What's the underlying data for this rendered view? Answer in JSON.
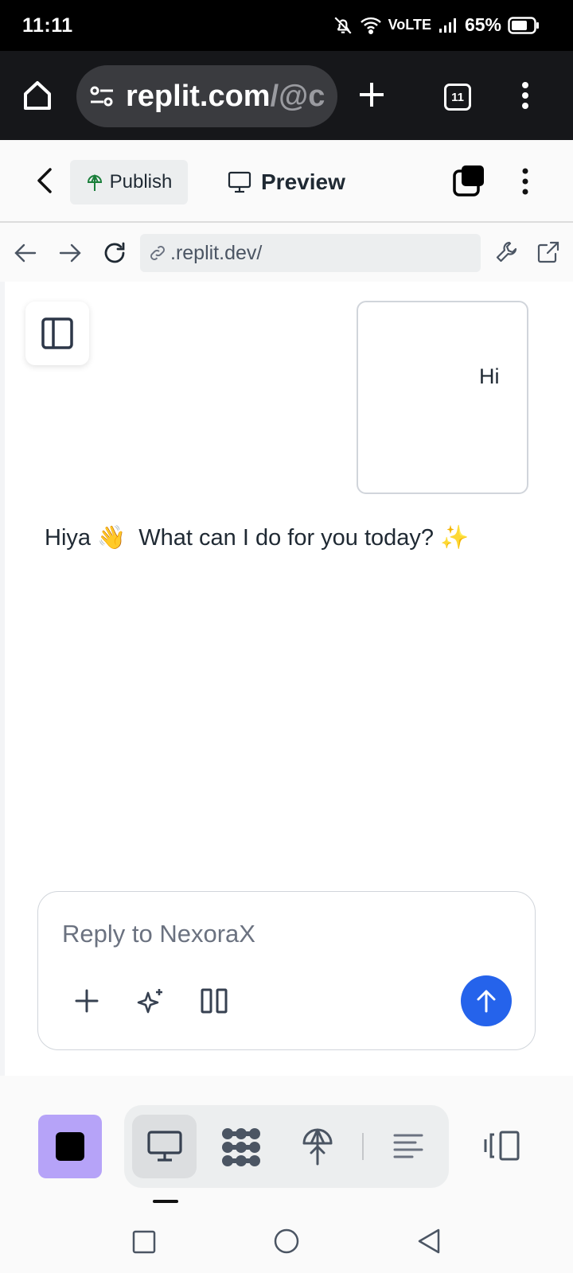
{
  "status_bar": {
    "time": "11:11",
    "network": "VoLTE",
    "battery": "65%"
  },
  "browser": {
    "url_domain": "replit.com",
    "url_path": "/@c",
    "tab_count": "11"
  },
  "toolbar": {
    "publish_label": "Publish",
    "preview_label": "Preview"
  },
  "address_bar": {
    "url": ".replit.dev/"
  },
  "chat": {
    "user_message": "Hi",
    "assistant_message": "Hiya 👋  What can I do for you today? ✨"
  },
  "composer": {
    "placeholder": "Reply to NexoraX"
  },
  "colors": {
    "accent": "#2563eb",
    "stop_button": "#b6a3f8",
    "browser_bar": "#16171a"
  },
  "icons": {
    "bottom_nav": [
      "stop-icon",
      "desktop-icon",
      "workflow-icon",
      "deploy-icon",
      "console-icon",
      "layout-icon"
    ],
    "composer": [
      "plus-icon",
      "sparkle-icon",
      "columns-icon",
      "send-arrow-icon"
    ]
  }
}
